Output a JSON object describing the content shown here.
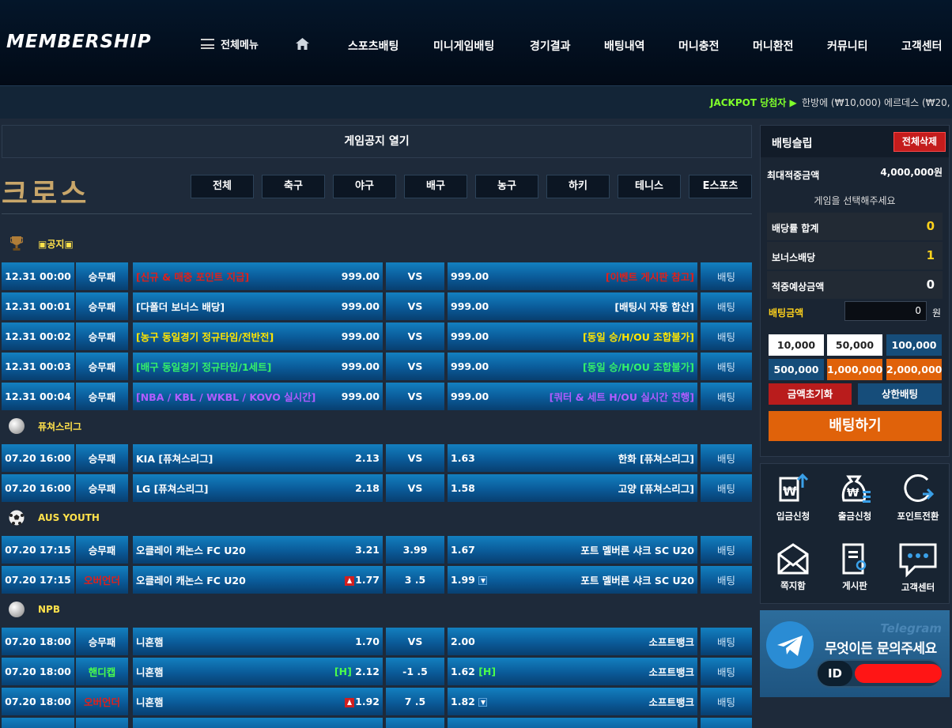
{
  "header": {
    "logo": "MEMBERSHIP",
    "menu_all": "전체메뉴",
    "nav": [
      "스포츠배팅",
      "미니게임배팅",
      "경기결과",
      "배팅내역",
      "머니충전",
      "머니환전",
      "커뮤니티",
      "고객센터"
    ]
  },
  "ticker": {
    "jackpot": "JACKPOT 당첨자 ▶",
    "text": "한방에 (₩10,000)  에르데스 (₩20,"
  },
  "notice_bar": "게임공지 열기",
  "section_title": "크로스",
  "tabs": [
    "전체",
    "축구",
    "야구",
    "배구",
    "농구",
    "하키",
    "테니스",
    "E스포츠"
  ],
  "leagues": [
    {
      "name": "▣공지▣",
      "icon": "trophy-icon"
    },
    {
      "name": "퓨쳐스리그",
      "icon": "baseball-icon"
    },
    {
      "name": "AUS YOUTH",
      "icon": "soccer-ball-icon"
    },
    {
      "name": "NPB",
      "icon": "baseball-icon"
    }
  ],
  "rows": [
    {
      "time": "12.31 00:00",
      "type": "승무패",
      "home": "[신규 & 매충 포인트 지급]",
      "home_odds": "999.00",
      "mid": "VS",
      "away_odds": "999.00",
      "away": "[이벤트 게시판 참고]",
      "bet": "배팅"
    },
    {
      "time": "12.31 00:01",
      "type": "승무패",
      "home": "[다폴더 보너스 배당]",
      "home_odds": "999.00",
      "mid": "VS",
      "away_odds": "999.00",
      "away": "[배팅시 자동 합산]",
      "bet": "배팅"
    },
    {
      "time": "12.31 00:02",
      "type": "승무패",
      "home": "[농구 동일경기 정규타임/전반전]",
      "home_odds": "999.00",
      "mid": "VS",
      "away_odds": "999.00",
      "away": "[동일 승/H/OU 조합불가]",
      "bet": "배팅"
    },
    {
      "time": "12.31 00:03",
      "type": "승무패",
      "home": "[배구 동일경기 정규타임/1세트]",
      "home_odds": "999.00",
      "mid": "VS",
      "away_odds": "999.00",
      "away": "[동일 승/H/OU 조합불가]",
      "bet": "배팅"
    },
    {
      "time": "12.31 00:04",
      "type": "승무패",
      "home": "[NBA / KBL / WKBL / KOVO 실시간]",
      "home_odds": "999.00",
      "mid": "VS",
      "away_odds": "999.00",
      "away": "[쿼터 & 세트 H/OU 실시간 진행]",
      "bet": "배팅"
    },
    {
      "time": "07.20 16:00",
      "type": "승무패",
      "home": "KIA [퓨쳐스리그]",
      "home_odds": "2.13",
      "mid": "VS",
      "away_odds": "1.63",
      "away": "한화 [퓨쳐스리그]",
      "bet": "배팅"
    },
    {
      "time": "07.20 16:00",
      "type": "승무패",
      "home": "LG [퓨쳐스리그]",
      "home_odds": "2.18",
      "mid": "VS",
      "away_odds": "1.58",
      "away": "고양 [퓨쳐스리그]",
      "bet": "배팅"
    },
    {
      "time": "07.20 17:15",
      "type": "승무패",
      "home": "오클레이 캐논스 FC U20",
      "home_odds": "3.21",
      "mid": "3.99",
      "away_odds": "1.67",
      "away": "포트 멜버른 샤크 SC U20",
      "bet": "배팅"
    },
    {
      "time": "07.20 17:15",
      "type": "오버언더",
      "home": "오클레이 캐논스 FC U20",
      "home_odds": "1.77",
      "mid": "3 .5",
      "away_odds": "1.99",
      "away": "포트 멜버른 샤크 SC U20",
      "bet": "배팅"
    },
    {
      "time": "07.20 18:00",
      "type": "승무패",
      "home": "니혼햄",
      "home_odds": "1.70",
      "mid": "VS",
      "away_odds": "2.00",
      "away": "소프트뱅크",
      "bet": "배팅"
    },
    {
      "time": "07.20 18:00",
      "type": "핸디캡",
      "home": "니혼햄",
      "home_tag": "[H]",
      "home_odds": "2.12",
      "mid": "-1 .5",
      "away_odds": "1.62",
      "away_tag": "[H]",
      "away": "소프트뱅크",
      "bet": "배팅"
    },
    {
      "time": "07.20 18:00",
      "type": "오버언더",
      "home": "니혼햄",
      "home_odds": "1.92",
      "mid": "7 .5",
      "away_odds": "1.82",
      "away": "소프트뱅크",
      "bet": "배팅"
    }
  ],
  "slip": {
    "title": "배팅슬립",
    "clear_all": "전체삭제",
    "max_label": "최대적중금액",
    "max_value": "4,000,000원",
    "select_prompt": "게임을 선택해주세요",
    "odds_sum_label": "배당률 합계",
    "odds_sum": "0",
    "bonus_label": "보너스배당",
    "bonus": "1",
    "expected_label": "적중예상금액",
    "expected": "0",
    "amount_label": "배팅금액",
    "amount_value": "0",
    "amount_unit": "원",
    "amounts": [
      "10,000",
      "50,000",
      "100,000",
      "500,000",
      "1,000,000",
      "2,000,000"
    ],
    "reset": "금액초기화",
    "max_bet": "상한배팅",
    "submit": "배팅하기"
  },
  "services": [
    {
      "label": "입금신청",
      "icon": "deposit-icon"
    },
    {
      "label": "출금신청",
      "icon": "withdraw-icon"
    },
    {
      "label": "포인트전환",
      "icon": "point-convert-icon"
    },
    {
      "label": "쪽지함",
      "icon": "message-icon"
    },
    {
      "label": "게시판",
      "icon": "board-icon"
    },
    {
      "label": "고객센터",
      "icon": "support-chat-icon"
    }
  ],
  "telegram": {
    "label": "Telegram",
    "text": "무엇이든 문의주세요",
    "id_label": "ID"
  },
  "colors": {
    "bg": "#1e2a3a",
    "row_blue": "#0a5a98",
    "red": "#e0201a",
    "gold": "#c8a66a",
    "orange": "#e0620a"
  }
}
